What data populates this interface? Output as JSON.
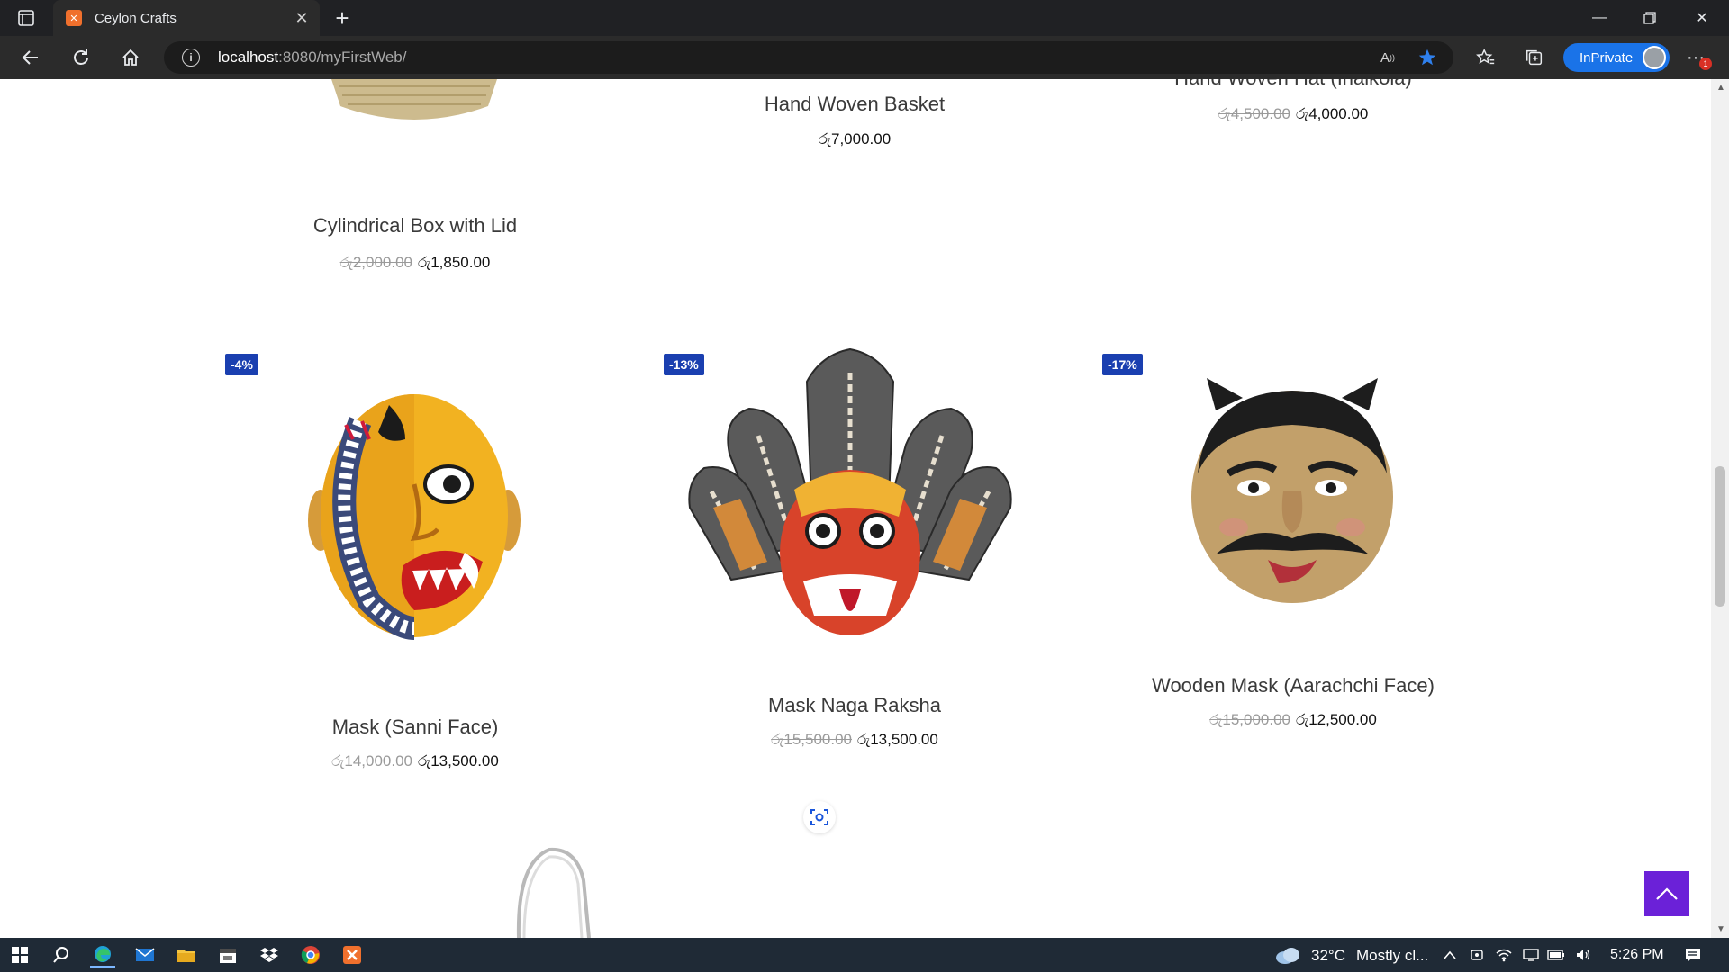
{
  "browser": {
    "tab_title": "Ceylon Crafts",
    "tab_favicon": "xampp-icon",
    "address_host": "localhost",
    "address_rest": ":8080/myFirstWeb/",
    "inprivate_label": "InPrivate",
    "notification_count": "1"
  },
  "products_top": [
    {
      "name": "Cylindrical Box with Lid",
      "old_price": "රු2,000.00",
      "price": "රු1,850.00"
    },
    {
      "name": "Hand Woven Basket",
      "old_price": "",
      "price": "රු7,000.00"
    },
    {
      "name": "Hand Woven Hat (Inalkola)",
      "old_price": "රු4,500.00",
      "price": "රු4,000.00"
    }
  ],
  "products_middle": [
    {
      "name": "Mask (Sanni Face)",
      "badge": "-4%",
      "old_price": "රු14,000.00",
      "price": "රු13,500.00"
    },
    {
      "name": "Mask Naga Raksha",
      "badge": "-13%",
      "old_price": "රු15,500.00",
      "price": "රු13,500.00"
    },
    {
      "name": "Wooden Mask (Aarachchi Face)",
      "badge": "-17%",
      "old_price": "රු15,000.00",
      "price": "රු12,500.00"
    }
  ],
  "colors": {
    "badge": "#1a3fb0",
    "back_to_top": "#6b21d8",
    "accent": "#1a73e8"
  },
  "taskbar": {
    "weather_temp": "32°C",
    "weather_text": "Mostly cl...",
    "time": "5:26 PM"
  }
}
